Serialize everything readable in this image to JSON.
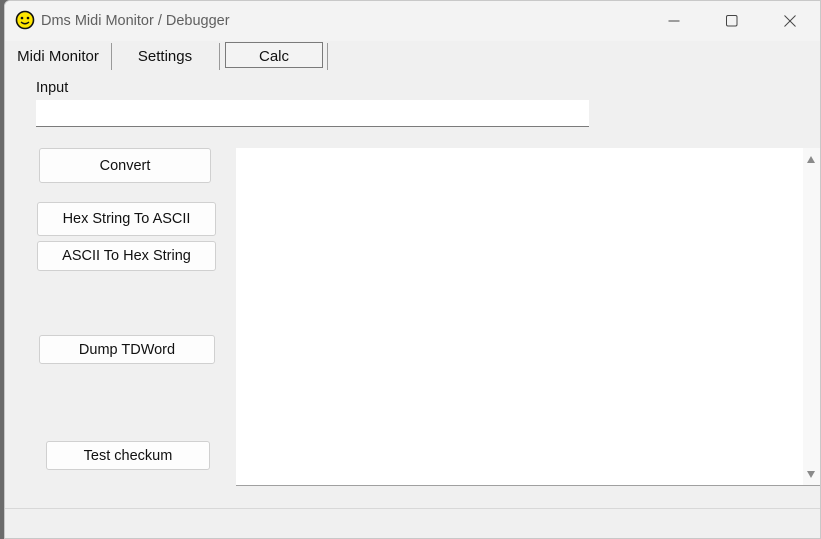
{
  "window": {
    "title": "Dms Midi Monitor / Debugger"
  },
  "tabs": [
    {
      "label": "Midi Monitor",
      "selected": false
    },
    {
      "label": "Settings",
      "selected": false
    },
    {
      "label": "Calc",
      "selected": true
    }
  ],
  "calc": {
    "input_label": "Input",
    "input_value": "",
    "buttons": {
      "convert": "Convert",
      "hex_to_ascii": "Hex String To ASCII",
      "ascii_to_hex": "ASCII To Hex String",
      "dump": "Dump TDWord",
      "checksum": "Test checkum"
    },
    "output_text": ""
  },
  "icons": {
    "app": "smiley-icon",
    "minimize": "minimize-icon",
    "maximize": "maximize-icon",
    "close": "close-icon",
    "scroll_up": "arrow-up-icon",
    "scroll_down": "arrow-down-icon"
  },
  "colors": {
    "window_bg": "#f0f0f0",
    "titlebar_bg": "#f3f3f3",
    "app_icon_fill": "#ffe600",
    "output_bg": "#ffffff"
  }
}
